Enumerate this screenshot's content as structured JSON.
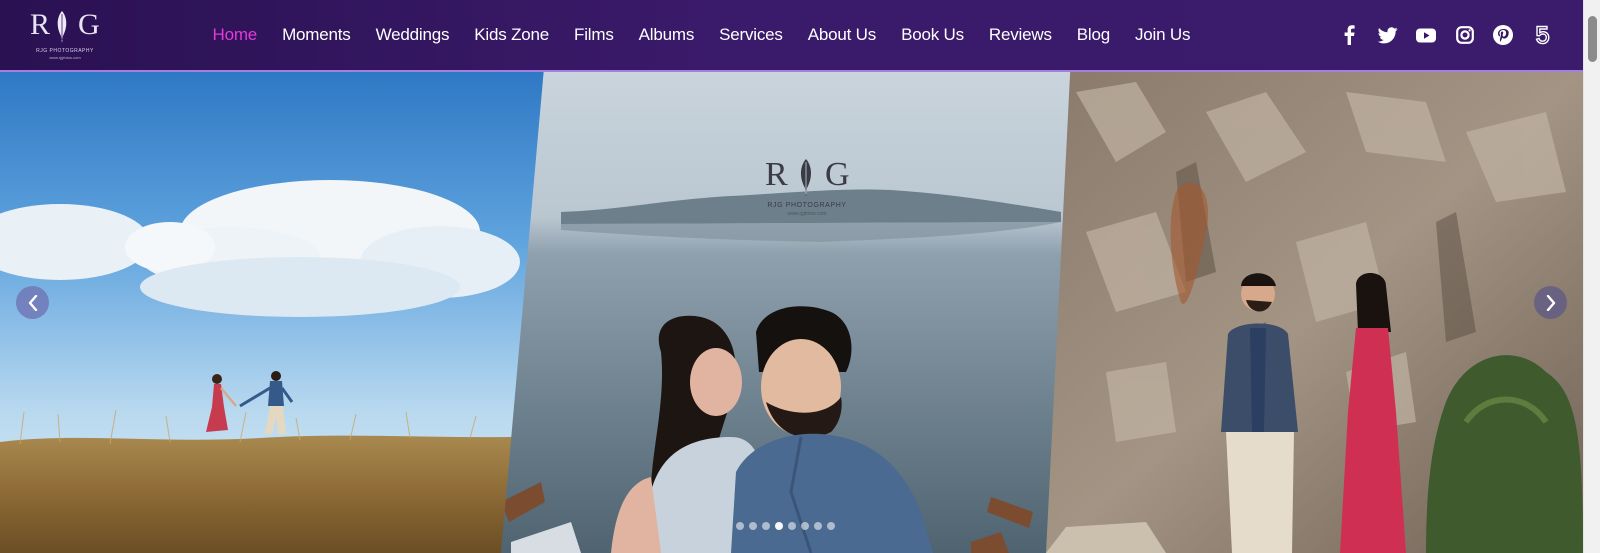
{
  "brand": {
    "logo_letter_left": "R",
    "logo_letter_right": "G",
    "tagline": "RJG PHOTOGRAPHY",
    "url": "www.rjgfotos.com"
  },
  "nav": {
    "items": [
      {
        "label": "Home",
        "active": true
      },
      {
        "label": "Moments",
        "active": false
      },
      {
        "label": "Weddings",
        "active": false
      },
      {
        "label": "Kids Zone",
        "active": false
      },
      {
        "label": "Films",
        "active": false
      },
      {
        "label": "Albums",
        "active": false
      },
      {
        "label": "Services",
        "active": false
      },
      {
        "label": "About Us",
        "active": false
      },
      {
        "label": "Book Us",
        "active": false
      },
      {
        "label": "Reviews",
        "active": false
      },
      {
        "label": "Blog",
        "active": false
      },
      {
        "label": "Join Us",
        "active": false
      }
    ],
    "active_color": "#e23ad9"
  },
  "social": [
    "facebook-icon",
    "twitter-icon",
    "youtube-icon",
    "instagram-icon",
    "pinterest-icon",
    "500px-icon"
  ],
  "slider": {
    "watermark_letter_left": "R",
    "watermark_letter_right": "G",
    "watermark_tagline": "RJG PHOTOGRAPHY",
    "watermark_url": "www.rjgfotos.com",
    "slides": [
      {
        "name": "couple-walking-field"
      },
      {
        "name": "couple-lake-kiss"
      },
      {
        "name": "couple-rock-wall"
      }
    ],
    "dot_count": 8,
    "active_dot": 3
  },
  "colors": {
    "header_bg": "#2e1459",
    "header_border": "#a57fe0",
    "nav_text": "#ffffff"
  }
}
